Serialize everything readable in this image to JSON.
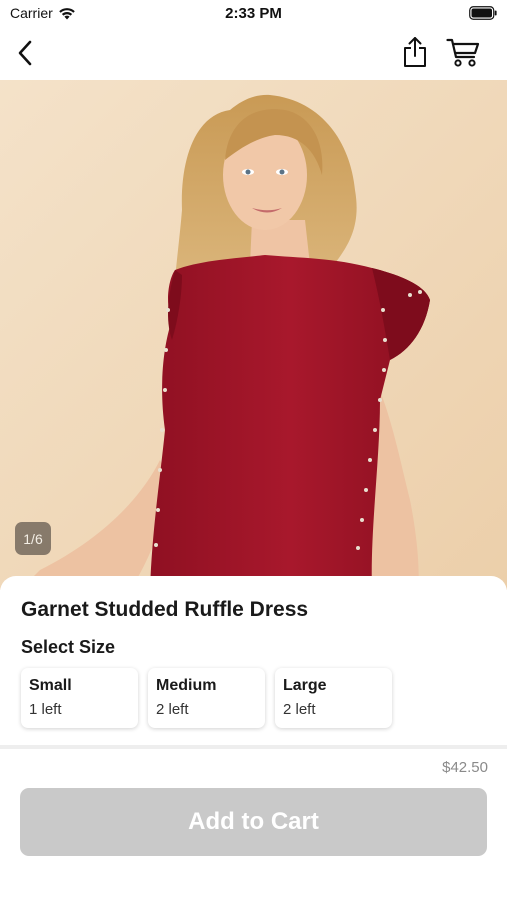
{
  "status_bar": {
    "carrier": "Carrier",
    "time": "2:33 PM"
  },
  "nav": {
    "back_icon": "chevron-left-icon",
    "share_icon": "share-icon",
    "cart_icon": "cart-icon"
  },
  "gallery": {
    "counter": "1/6",
    "current_index": 1,
    "total": 6
  },
  "product": {
    "title": "Garnet Studded Ruffle Dress",
    "size_heading": "Select Size",
    "sizes": [
      {
        "name": "Small",
        "stock": "1 left"
      },
      {
        "name": "Medium",
        "stock": "2 left"
      },
      {
        "name": "Large",
        "stock": "2 left"
      }
    ],
    "price": "$42.50"
  },
  "actions": {
    "add_to_cart_label": "Add to Cart"
  },
  "colors": {
    "dress": "#a3162a",
    "background": "#f2dcc0",
    "button_disabled": "#c9c9c9"
  }
}
